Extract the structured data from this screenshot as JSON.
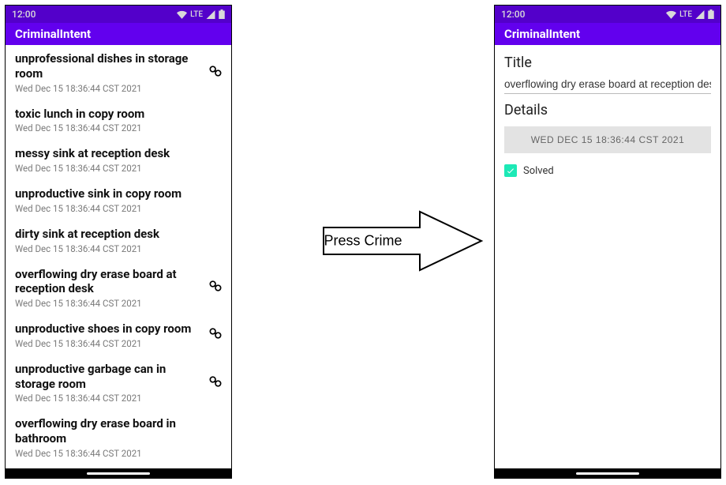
{
  "status": {
    "time": "12:00",
    "network": "LTE"
  },
  "app": {
    "title": "CriminalIntent"
  },
  "list": {
    "items": [
      {
        "title": "unprofessional dishes in storage room",
        "date": "Wed Dec 15 18:36:44 CST 2021",
        "solved": true
      },
      {
        "title": "toxic lunch in copy room",
        "date": "Wed Dec 15 18:36:44 CST 2021",
        "solved": false
      },
      {
        "title": "messy sink at reception desk",
        "date": "Wed Dec 15 18:36:44 CST 2021",
        "solved": false
      },
      {
        "title": "unproductive sink in copy room",
        "date": "Wed Dec 15 18:36:44 CST 2021",
        "solved": false
      },
      {
        "title": "dirty sink at reception desk",
        "date": "Wed Dec 15 18:36:44 CST 2021",
        "solved": false
      },
      {
        "title": "overflowing dry erase board at reception desk",
        "date": "Wed Dec 15 18:36:44 CST 2021",
        "solved": true
      },
      {
        "title": "unproductive shoes in copy room",
        "date": "Wed Dec 15 18:36:44 CST 2021",
        "solved": true
      },
      {
        "title": "unproductive garbage can in storage room",
        "date": "Wed Dec 15 18:36:44 CST 2021",
        "solved": true
      },
      {
        "title": "overflowing dry erase board in bathroom",
        "date": "Wed Dec 15 18:36:44 CST 2021",
        "solved": false
      }
    ]
  },
  "detail": {
    "title_label": "Title",
    "title_value": "overflowing dry erase board at reception desk",
    "details_label": "Details",
    "date_button": "WED DEC 15 18:36:44 CST 2021",
    "solved_label": "Solved",
    "solved_checked": true
  },
  "arrow": {
    "label": "Press Crime"
  }
}
